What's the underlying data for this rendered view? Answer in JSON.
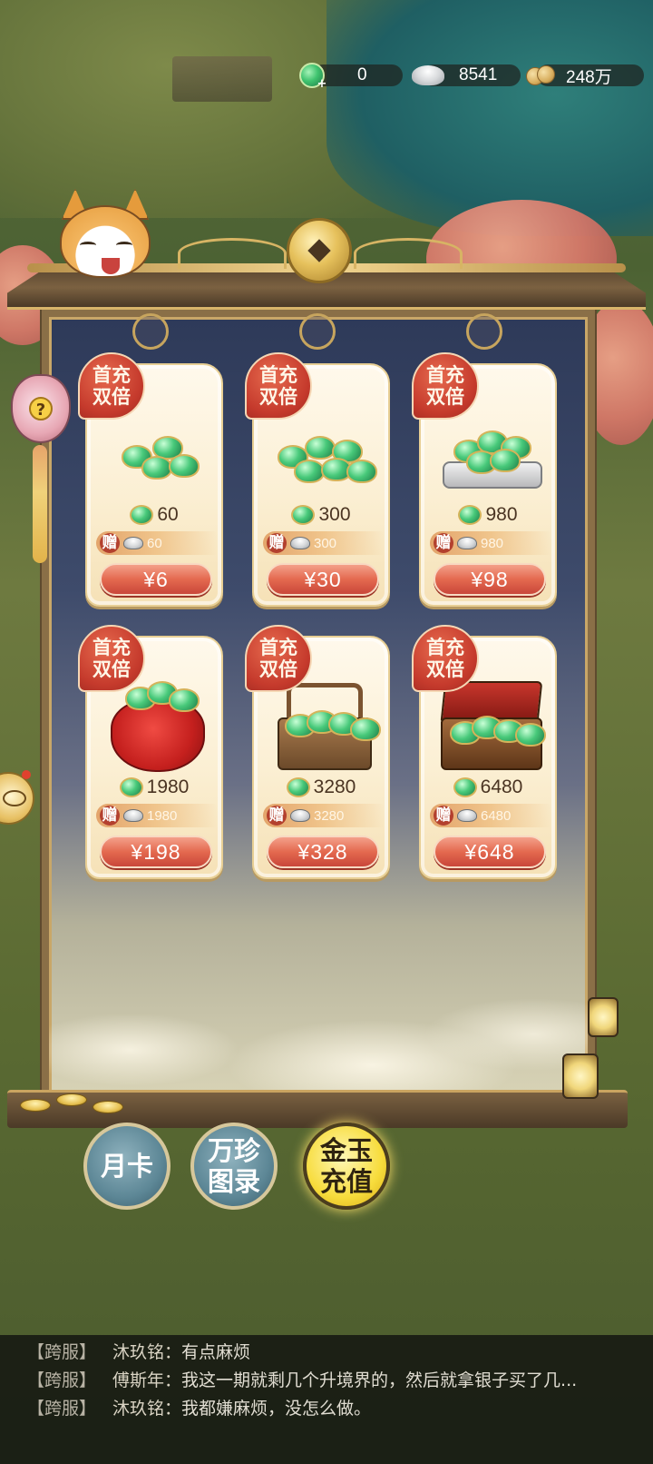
{
  "currency": {
    "jade_icon": "jade-gem-plus-icon",
    "jade": "0",
    "silver_icon": "silver-ingot-icon",
    "silver": "8541",
    "coin_icon": "copper-coins-icon",
    "coins": "248万"
  },
  "shop": {
    "badge_line1": "首充",
    "badge_line2": "双倍",
    "gift_label": "赠",
    "items": [
      {
        "amount": "60",
        "gift": "60",
        "price": "¥6",
        "art": "jade-pile-small"
      },
      {
        "amount": "300",
        "gift": "300",
        "price": "¥30",
        "art": "jade-pile-medium"
      },
      {
        "amount": "980",
        "gift": "980",
        "price": "¥98",
        "art": "jade-tray"
      },
      {
        "amount": "1980",
        "gift": "1980",
        "price": "¥198",
        "art": "jade-red-pouch"
      },
      {
        "amount": "3280",
        "gift": "3280",
        "price": "¥328",
        "art": "jade-basket"
      },
      {
        "amount": "6480",
        "gift": "6480",
        "price": "¥648",
        "art": "jade-treasure-chest"
      }
    ]
  },
  "tabs": [
    {
      "label": "月卡",
      "active": false
    },
    {
      "label": "万珍图录",
      "active": false
    },
    {
      "label": "金玉充值",
      "active": true
    }
  ],
  "chat": [
    {
      "channel": "【跨服】",
      "name": "沐玖铭",
      "text": "有点麻烦"
    },
    {
      "channel": "【跨服】",
      "name": "傅斯年",
      "text": "我这一期就剩几个升境界的，然后就拿银子买了几..."
    },
    {
      "channel": "【跨服】",
      "name": "沐玖铭",
      "text": "我都嫌麻烦，没怎么做。"
    }
  ]
}
